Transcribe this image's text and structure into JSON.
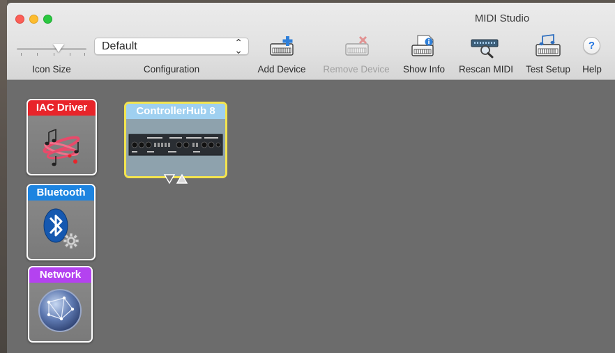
{
  "window": {
    "title": "MIDI Studio"
  },
  "toolbar": {
    "icon_size_label": "Icon Size",
    "configuration_label": "Configuration",
    "configuration_value": "Default",
    "add_device_label": "Add Device",
    "remove_device_label": "Remove Device",
    "show_info_label": "Show Info",
    "rescan_midi_label": "Rescan MIDI",
    "test_setup_label": "Test Setup",
    "help_label": "Help",
    "help_glyph": "?"
  },
  "drivers": [
    {
      "label": "IAC Driver",
      "color": "#e8242a",
      "icon": "music-notes-icon"
    },
    {
      "label": "Bluetooth",
      "color": "#1d84e0",
      "icon": "bluetooth-icon"
    },
    {
      "label": "Network",
      "color": "#b442f0",
      "icon": "globe-icon"
    }
  ],
  "devices": [
    {
      "label": "ControllerHub 8",
      "header_color": "#9fd0f0",
      "selected_border": "#f3e44f"
    }
  ]
}
